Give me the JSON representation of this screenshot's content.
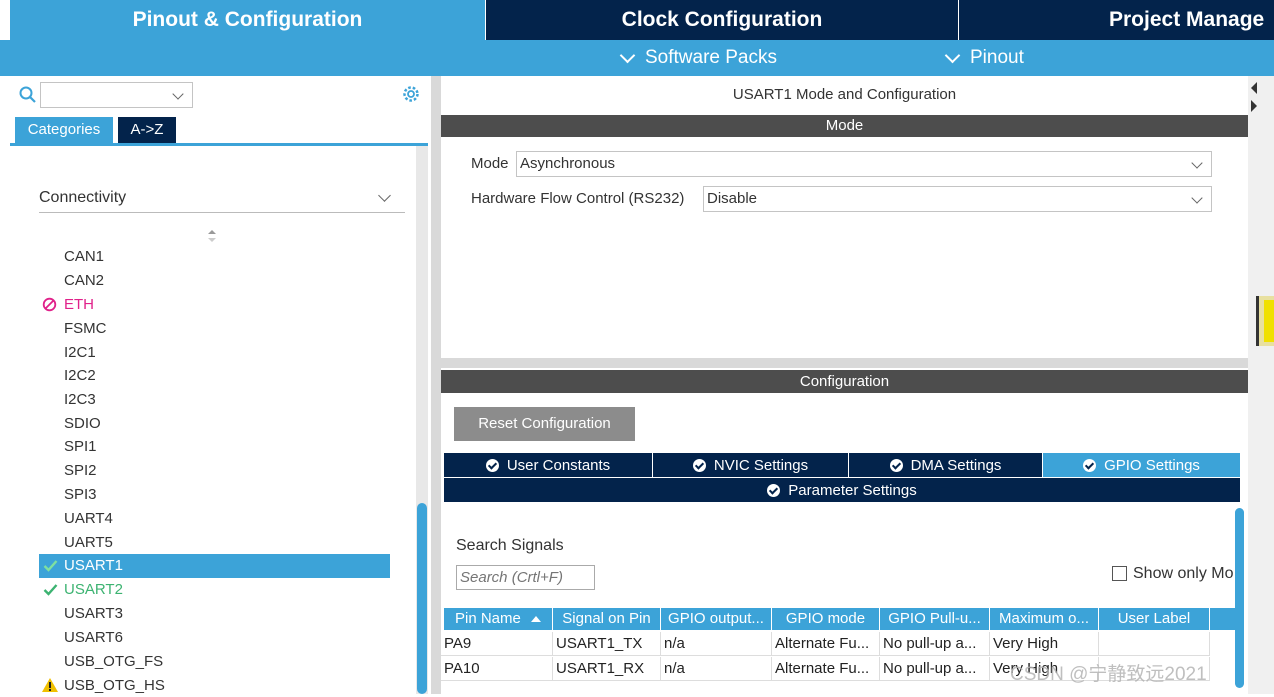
{
  "top_tabs": {
    "pinout": "Pinout & Configuration",
    "clock": "Clock Configuration",
    "project": "Project Manage"
  },
  "sub_menu": {
    "software_packs": "Software Packs",
    "pinout": "Pinout"
  },
  "sidebar": {
    "search_value": "",
    "tab_categories": "Categories",
    "tab_az": "A->Z",
    "group": "Connectivity",
    "items": [
      {
        "label": "CAN1",
        "status": "none"
      },
      {
        "label": "CAN2",
        "status": "none"
      },
      {
        "label": "ETH",
        "status": "disabled"
      },
      {
        "label": "FSMC",
        "status": "none"
      },
      {
        "label": "I2C1",
        "status": "none"
      },
      {
        "label": "I2C2",
        "status": "none"
      },
      {
        "label": "I2C3",
        "status": "none"
      },
      {
        "label": "SDIO",
        "status": "none"
      },
      {
        "label": "SPI1",
        "status": "none"
      },
      {
        "label": "SPI2",
        "status": "none"
      },
      {
        "label": "SPI3",
        "status": "none"
      },
      {
        "label": "UART4",
        "status": "none"
      },
      {
        "label": "UART5",
        "status": "none"
      },
      {
        "label": "USART1",
        "status": "selected-ok"
      },
      {
        "label": "USART2",
        "status": "ok"
      },
      {
        "label": "USART3",
        "status": "none"
      },
      {
        "label": "USART6",
        "status": "none"
      },
      {
        "label": "USB_OTG_FS",
        "status": "none"
      },
      {
        "label": "USB_OTG_HS",
        "status": "warning"
      }
    ]
  },
  "mode_panel": {
    "title": "USART1 Mode and Configuration",
    "header": "Mode",
    "mode_label": "Mode",
    "mode_value": "Asynchronous",
    "flow_label": "Hardware Flow Control (RS232)",
    "flow_value": "Disable"
  },
  "config_panel": {
    "header": "Configuration",
    "reset_button": "Reset Configuration",
    "tabs": [
      "User Constants",
      "NVIC Settings",
      "DMA Settings",
      "GPIO Settings"
    ],
    "tab_param": "Parameter Settings",
    "search_label": "Search Signals",
    "search_placeholder": "Search (Crtl+F)",
    "show_only": "Show only Mo",
    "columns": [
      "Pin Name",
      "Signal on Pin",
      "GPIO output...",
      "GPIO mode",
      "GPIO Pull-u...",
      "Maximum o...",
      "User Label"
    ],
    "rows": [
      [
        "PA9",
        "USART1_TX",
        "n/a",
        "Alternate Fu...",
        "No pull-up a...",
        "Very High",
        ""
      ],
      [
        "PA10",
        "USART1_RX",
        "n/a",
        "Alternate Fu...",
        "No pull-up a...",
        "Very High",
        ""
      ]
    ]
  },
  "watermark": "CSDN @宁静致远2021",
  "colors": {
    "accent": "#3ca3d8",
    "navy": "#03234b",
    "header_gray": "#4d4d4d",
    "ok_green": "#3cb371",
    "disabled_pink": "#e0218a",
    "warning_yellow": "#f0c000"
  }
}
